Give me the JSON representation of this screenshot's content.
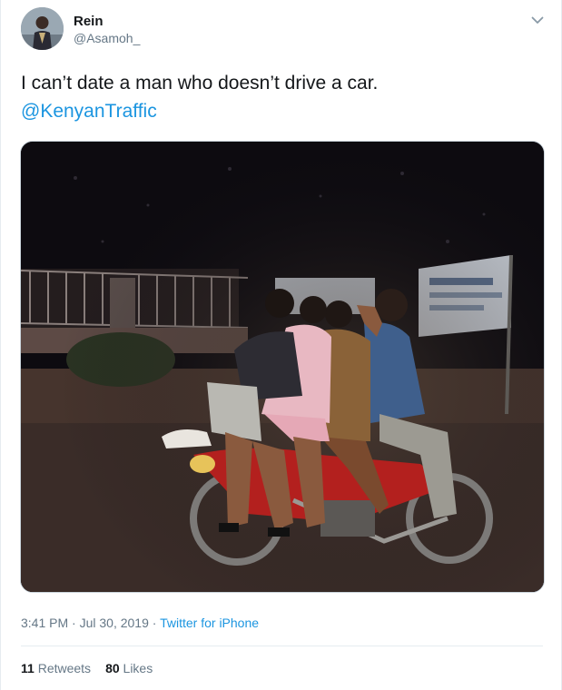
{
  "tweet": {
    "author_name": "Rein",
    "author_handle": "@Asamoh_",
    "text": "I can’t date a man who doesn’t drive a car.",
    "mention": "@KenyanTraffic",
    "time": "3:41 PM",
    "date": "Jul 30, 2019",
    "separator": " · ",
    "source": "Twitter for iPhone",
    "retweets_count": "11",
    "retweets_label": "Retweets",
    "likes_count": "80",
    "likes_label": "Likes"
  },
  "icons": {
    "more": "chevron-down-icon"
  },
  "colors": {
    "link": "#1b95e0",
    "secondary_text": "#657786",
    "primary_text": "#14171a",
    "divider": "#e6ecf0"
  }
}
